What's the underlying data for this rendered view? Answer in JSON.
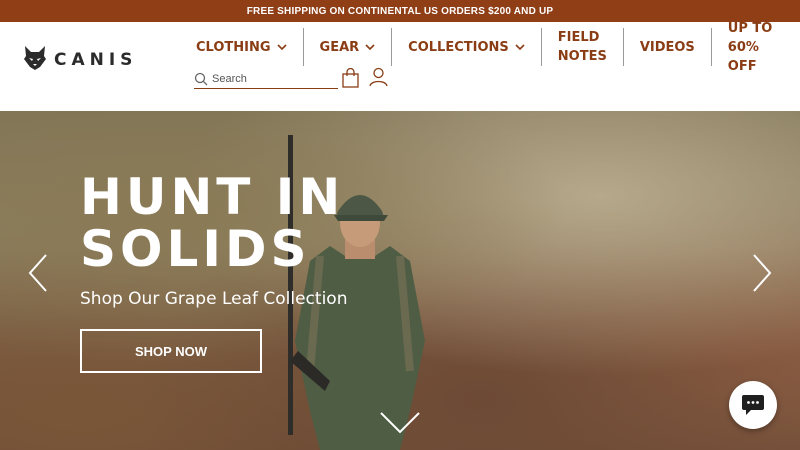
{
  "promo": {
    "text": "FREE SHIPPING ON CONTINENTAL US ORDERS $200 AND UP"
  },
  "brand": {
    "name": "CANIS",
    "logo_icon": "wolf-head-icon"
  },
  "nav": {
    "items": [
      {
        "label": "CLOTHING",
        "has_dropdown": true
      },
      {
        "label": "GEAR",
        "has_dropdown": true
      },
      {
        "label": "COLLECTIONS",
        "has_dropdown": true
      },
      {
        "label": "FIELD\nNOTES",
        "has_dropdown": false
      },
      {
        "label": "VIDEOS",
        "has_dropdown": false
      },
      {
        "label": "UP TO\n60% OFF",
        "has_dropdown": false
      }
    ]
  },
  "search": {
    "placeholder": "Search",
    "icon": "search-icon"
  },
  "icons": {
    "cart": "shopping-bag-icon",
    "account": "user-icon",
    "chat": "chat-bubble-icon"
  },
  "hero": {
    "title": "HUNT IN SOLIDS",
    "subtitle": "Shop Our Grape Leaf Collection",
    "cta_label": "SHOP NOW"
  },
  "colors": {
    "brand": "#8f3e16",
    "text_accent": "#8a3d14",
    "white": "#ffffff"
  }
}
